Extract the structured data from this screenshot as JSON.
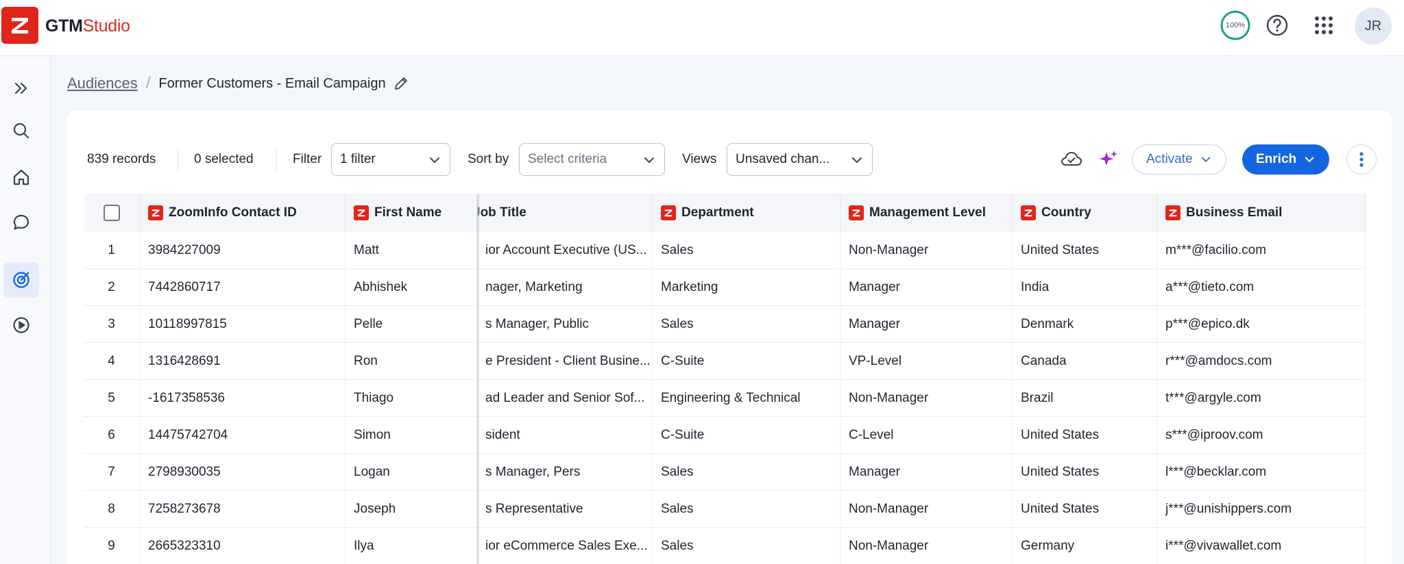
{
  "app": {
    "brand_part1": "GTM",
    "brand_part2": "Studio",
    "progress_label": "100%",
    "avatar_initials": "JR"
  },
  "colors": {
    "brand_red": "#e1251b",
    "primary_blue": "#1565e0",
    "ai_purple": "#a02bd8",
    "progress_teal": "#1f9e8a"
  },
  "icons": {
    "header": [
      "progress-ring-icon",
      "help-icon",
      "apps-grid-icon"
    ],
    "sidebar": [
      "expand-icon",
      "search-icon",
      "home-icon",
      "chat-icon",
      "target-icon",
      "play-icon"
    ],
    "toolbar": [
      "cloud-sync-icon",
      "sparkle-ai-icon",
      "more-vertical-icon"
    ]
  },
  "breadcrumb": {
    "parent": "Audiences",
    "separator": "/",
    "current": "Former Customers - Email Campaign"
  },
  "toolbar": {
    "records": "839 records",
    "selected": "0 selected",
    "filter_label": "Filter",
    "filter_value": "1 filter",
    "sort_label": "Sort by",
    "sort_placeholder": "Select criteria",
    "views_label": "Views",
    "views_value": "Unsaved chan...",
    "activate_label": "Activate",
    "enrich_label": "Enrich"
  },
  "table": {
    "columns": [
      "ZoomInfo Contact ID",
      "First Name",
      "Job Title",
      "Department",
      "Management Level",
      "Country",
      "Business Email"
    ],
    "rows": [
      {
        "n": "1",
        "id": "3984227009",
        "first": "Matt",
        "title": "ior Account Executive (US...",
        "dept": "Sales",
        "level": "Non-Manager",
        "country": "United States",
        "email": "m***@facilio.com"
      },
      {
        "n": "2",
        "id": "7442860717",
        "first": "Abhishek",
        "title": "nager, Marketing",
        "dept": "Marketing",
        "level": "Manager",
        "country": "India",
        "email": "a***@tieto.com"
      },
      {
        "n": "3",
        "id": "10118997815",
        "first": "Pelle",
        "title": "s Manager, Public",
        "dept": "Sales",
        "level": "Manager",
        "country": "Denmark",
        "email": "p***@epico.dk"
      },
      {
        "n": "4",
        "id": "1316428691",
        "first": "Ron",
        "title": "e President - Client Busine...",
        "dept": "C-Suite",
        "level": "VP-Level",
        "country": "Canada",
        "email": "r***@amdocs.com"
      },
      {
        "n": "5",
        "id": "-1617358536",
        "first": "Thiago",
        "title": "ad Leader and Senior Sof...",
        "dept": "Engineering & Technical",
        "level": "Non-Manager",
        "country": "Brazil",
        "email": "t***@argyle.com"
      },
      {
        "n": "6",
        "id": "14475742704",
        "first": "Simon",
        "title": "sident",
        "dept": "C-Suite",
        "level": "C-Level",
        "country": "United States",
        "email": "s***@iproov.com"
      },
      {
        "n": "7",
        "id": "2798930035",
        "first": "Logan",
        "title": "s Manager, Pers",
        "dept": "Sales",
        "level": "Manager",
        "country": "United States",
        "email": "l***@becklar.com"
      },
      {
        "n": "8",
        "id": "7258273678",
        "first": "Joseph",
        "title": "s Representative",
        "dept": "Sales",
        "level": "Non-Manager",
        "country": "United States",
        "email": "j***@unishippers.com"
      },
      {
        "n": "9",
        "id": "2665323310",
        "first": "Ilya",
        "title": "ior eCommerce Sales Exe...",
        "dept": "Sales",
        "level": "Non-Manager",
        "country": "Germany",
        "email": "i***@vivawallet.com"
      }
    ]
  }
}
